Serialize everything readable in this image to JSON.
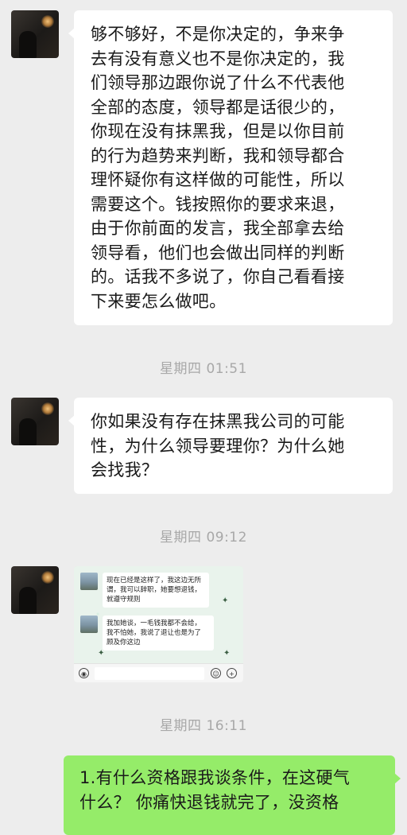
{
  "messages": [
    {
      "sender": "contact",
      "text_lines": [
        "够不够好，不是你决定的，争来争",
        "去有没有意义也不是你决定的，我",
        "们领导那边跟你说了什么不代表他",
        "全部的态度，领导都是话很少的，",
        "你现在没有抹黑我，但是以你目前",
        "的行为趋势来判断，我和领导都合",
        "理怀疑你有这样做的可能性，所以",
        "需要这个。钱按照你的要求来退，",
        "由于你前面的发言，我全部拿去给",
        "领导看，他们也会做出同样的判断",
        "的。话我不多说了，你自己看看接",
        "下来要怎么做吧。"
      ]
    },
    {
      "sender": "contact",
      "text_lines": [
        "你如果没有存在抹黑我公司的可能",
        "性，为什么领导要理你？为什么她",
        "会找我？"
      ]
    },
    {
      "sender": "contact",
      "type": "image",
      "image_bubbles": [
        [
          "现在已经是这样了，我这边无所",
          "谓，我可以辞职，她要想退钱，",
          "就遵守规则"
        ],
        [
          "我加她谈，一毛钱我都不会给，",
          "我不怕她，我说了退让也是为了",
          "顾及你这边"
        ]
      ]
    },
    {
      "sender": "me",
      "text_lines": [
        "1.有什么资格跟我谈条件，在这硬气",
        "什么？ 你痛快退钱就完了，没资格"
      ]
    }
  ],
  "timestamps": [
    "星期四 01:51",
    "星期四 09:12",
    "星期四 16:11"
  ],
  "icons": {
    "avatar": "contact-avatar",
    "voice": "voice-icon",
    "emoji": "emoji-icon",
    "plus": "plus-icon"
  },
  "colors": {
    "background": "#ededed",
    "incoming_bubble": "#ffffff",
    "outgoing_bubble": "#95ec69",
    "timestamp_text": "#a8a8a8"
  }
}
